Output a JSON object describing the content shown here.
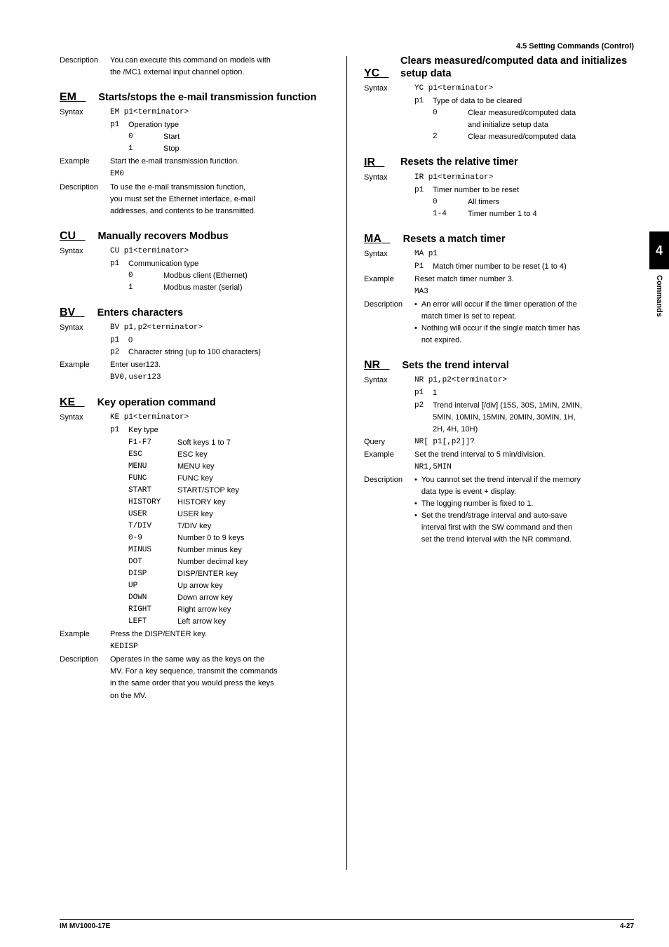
{
  "header": {
    "section": "4.5  Setting Commands (Control)"
  },
  "sideTab": {
    "number": "4",
    "label": "Commands"
  },
  "footer": {
    "left": "IM MV1000-17E",
    "right": "4-27"
  },
  "left": {
    "intro": {
      "label": "Description",
      "line1": "You can execute this command on models with",
      "line2": "the /MC1 external input channel option."
    },
    "EM": {
      "code": "EM   ",
      "title": "Starts/stops the e-mail transmission function",
      "syntaxLabel": "Syntax",
      "syntaxLine": "EM p1<terminator>",
      "p1Label": "p1",
      "p1Desc": "Operation type",
      "opt0k": "0",
      "opt0v": "Start",
      "opt1k": "1",
      "opt1v": "Stop",
      "exampleLabel": "Example",
      "exampleText": "Start the e-mail transmission function.",
      "exampleCode": "EM0",
      "descLabel": "Description",
      "desc1": "To use the e-mail transmission function,",
      "desc2": "you must set the Ethernet interface, e-mail",
      "desc3": "addresses, and contents to be transmitted."
    },
    "CU": {
      "code": "CU   ",
      "title": "Manually recovers Modbus",
      "syntaxLabel": "Syntax",
      "syntaxLine": "CU p1<terminator>",
      "p1Label": "p1",
      "p1Desc": "Communication type",
      "opt0k": "0",
      "opt0v": "Modbus client (Ethernet)",
      "opt1k": "1",
      "opt1v": "Modbus master (serial)"
    },
    "BV": {
      "code": "BV   ",
      "title": "Enters characters",
      "syntaxLabel": "Syntax",
      "syntaxLine": "BV p1,p2<terminator>",
      "p1Label": "p1",
      "p1Desc": "0",
      "p2Label": "p2",
      "p2Desc": "Character string (up to 100 characters)",
      "exampleLabel": "Example",
      "exampleText": "Enter user123.",
      "exampleCode": "BV0,user123"
    },
    "KE": {
      "code": "KE   ",
      "title": "Key operation command",
      "syntaxLabel": "Syntax",
      "syntaxLine": "KE p1<terminator>",
      "p1Label": "p1",
      "p1Desc": "Key type",
      "keys": [
        {
          "k": "F1-F7",
          "v": "Soft keys 1 to 7"
        },
        {
          "k": "ESC",
          "v": "ESC key"
        },
        {
          "k": "MENU",
          "v": "MENU key"
        },
        {
          "k": "FUNC",
          "v": "FUNC key"
        },
        {
          "k": "START",
          "v": "START/STOP key"
        },
        {
          "k": "HISTORY",
          "v": "HISTORY key"
        },
        {
          "k": "USER",
          "v": "USER key"
        },
        {
          "k": "T/DIV",
          "v": "T/DIV key"
        },
        {
          "k": "0-9",
          "v": "Number 0 to 9 keys"
        },
        {
          "k": "MINUS",
          "v": "Number minus key"
        },
        {
          "k": "DOT",
          "v": "Number decimal key"
        },
        {
          "k": "DISP",
          "v": "DISP/ENTER key"
        },
        {
          "k": "UP",
          "v": "Up arrow key"
        },
        {
          "k": "DOWN",
          "v": "Down arrow key"
        },
        {
          "k": "RIGHT",
          "v": "Right arrow key"
        },
        {
          "k": "LEFT",
          "v": "Left arrow key"
        }
      ],
      "exampleLabel": "Example",
      "exampleText": "Press the DISP/ENTER key.",
      "exampleCode": "KEDISP",
      "descLabel": "Description",
      "desc1": "Operates in the same way as the keys on the",
      "desc2": "MV. For a key sequence, transmit the commands",
      "desc3": "in the same order that you would press the keys",
      "desc4": "on the MV."
    }
  },
  "right": {
    "YC": {
      "code": "YC   ",
      "title": "Clears measured/computed data and initializes setup data",
      "syntaxLabel": "Syntax",
      "syntaxLine": "YC p1<terminator>",
      "p1Label": "p1",
      "p1Desc": "Type of data to be cleared",
      "opt0k": "0",
      "opt0v1": "Clear measured/computed data",
      "opt0v2": "and initialize setup data",
      "opt2k": "2",
      "opt2v": "Clear measured/computed data"
    },
    "IR": {
      "code": "IR   ",
      "title": "Resets the relative timer",
      "syntaxLabel": "Syntax",
      "syntaxLine": "IR p1<terminator>",
      "p1Label": "p1",
      "p1Desc": "Timer number to be reset",
      "opt0k": "0",
      "opt0v": "All timers",
      "opt1k": "1-4",
      "opt1v": "Timer number 1 to 4"
    },
    "MA": {
      "code": "MA   ",
      "title": "Resets a match timer",
      "syntaxLabel": "Syntax",
      "syntaxLine": "MA p1",
      "p1Label": "P1",
      "p1Desc": "Match timer number to be reset (1 to 4)",
      "exampleLabel": "Example",
      "exampleText": "Reset match timer number 3.",
      "exampleCode": "MA3",
      "descLabel": "Description",
      "b1a": "An error will occur if the timer operation of the",
      "b1b": "match timer is set to repeat.",
      "b2a": "Nothing will occur if the single match timer has",
      "b2b": "not expired."
    },
    "NR": {
      "code": "NR   ",
      "title": "Sets the trend interval",
      "syntaxLabel": "Syntax",
      "syntaxLine": "NR p1,p2<terminator>",
      "p1Label": "p1",
      "p1Desc": "1",
      "p2Label": "p2",
      "p2Desc1": "Trend interval [/div] (15S, 30S, 1MIN, 2MIN,",
      "p2Desc2": "5MIN, 10MIN, 15MIN, 20MIN, 30MIN, 1H,",
      "p2Desc3": "2H, 4H, 10H)",
      "queryLabel": "Query",
      "queryLine": "NR[ p1[,p2]]?",
      "exampleLabel": "Example",
      "exampleText": "Set the trend interval to 5 min/division.",
      "exampleCode": "NR1,5MIN",
      "descLabel": "Description",
      "b1a": "You cannot set the trend interval if the memory",
      "b1b": "data type is event + display.",
      "b2": "The logging number is fixed to 1.",
      "b3a": "Set the trend/strage interval and auto-save",
      "b3b": "interval first with the SW command and then",
      "b3c": "set the trend interval with the NR command."
    }
  }
}
